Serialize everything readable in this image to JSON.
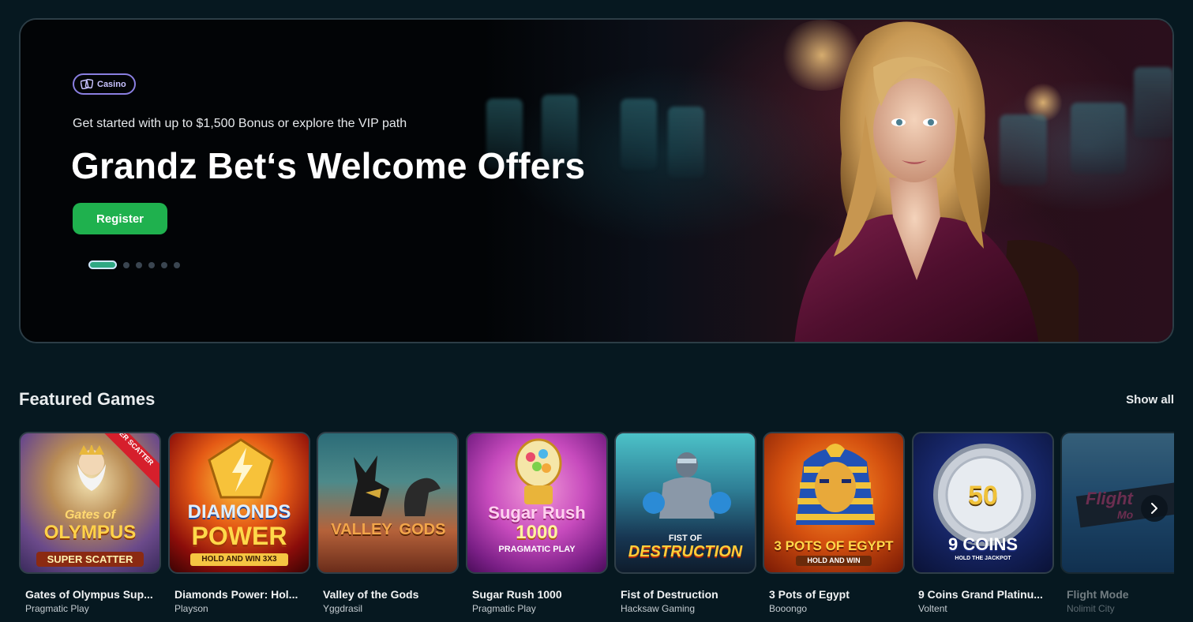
{
  "hero": {
    "badge_label": "Casino",
    "badge_icon": "cards-icon",
    "subtitle": "Get started with up to $1,500 Bonus or explore the VIP path",
    "title": "Grandz Bet‘s Welcome Offers",
    "register_label": "Register",
    "slide_count": 6,
    "active_slide": 1
  },
  "featured": {
    "title": "Featured Games",
    "show_all_label": "Show all",
    "next_icon": "chevron-right-icon",
    "games": [
      {
        "title": "Gates of Olympus Sup...",
        "provider": "Pragmatic Play",
        "art": [
          "Gates of",
          "OLYMPUS",
          "SUPER SCATTER"
        ],
        "corner": "SUPER SCATTER"
      },
      {
        "title": "Diamonds Power: Hol...",
        "provider": "Playson",
        "art": [
          "DIAMONDS",
          "POWER",
          "HOLD AND WIN 3X3"
        ]
      },
      {
        "title": "Valley of the Gods",
        "provider": "Yggdrasil",
        "art": [
          "VALLEY",
          "GODS"
        ]
      },
      {
        "title": "Sugar Rush 1000",
        "provider": "Pragmatic Play",
        "art": [
          "Sugar Rush",
          "1000",
          "PRAGMATIC PLAY"
        ]
      },
      {
        "title": "Fist of Destruction",
        "provider": "Hacksaw Gaming",
        "art": [
          "FIST OF",
          "DESTRUCTION"
        ]
      },
      {
        "title": "3 Pots of Egypt",
        "provider": "Booongo",
        "art": [
          "3 POTS OF EGYPT",
          "HOLD AND WIN"
        ]
      },
      {
        "title": "9 Coins Grand Platinu...",
        "provider": "Voltent",
        "art": [
          "50",
          "9 COINS",
          "HOLD THE JACKPOT"
        ]
      },
      {
        "title": "Flight Mode",
        "provider": "Nolimit City",
        "art": [
          "Flight",
          "Mo"
        ]
      }
    ]
  },
  "colors": {
    "background": "#061820",
    "register_green": "#1fb14e",
    "badge_purple": "#8a7fe0",
    "active_dot": "#2fa883"
  }
}
